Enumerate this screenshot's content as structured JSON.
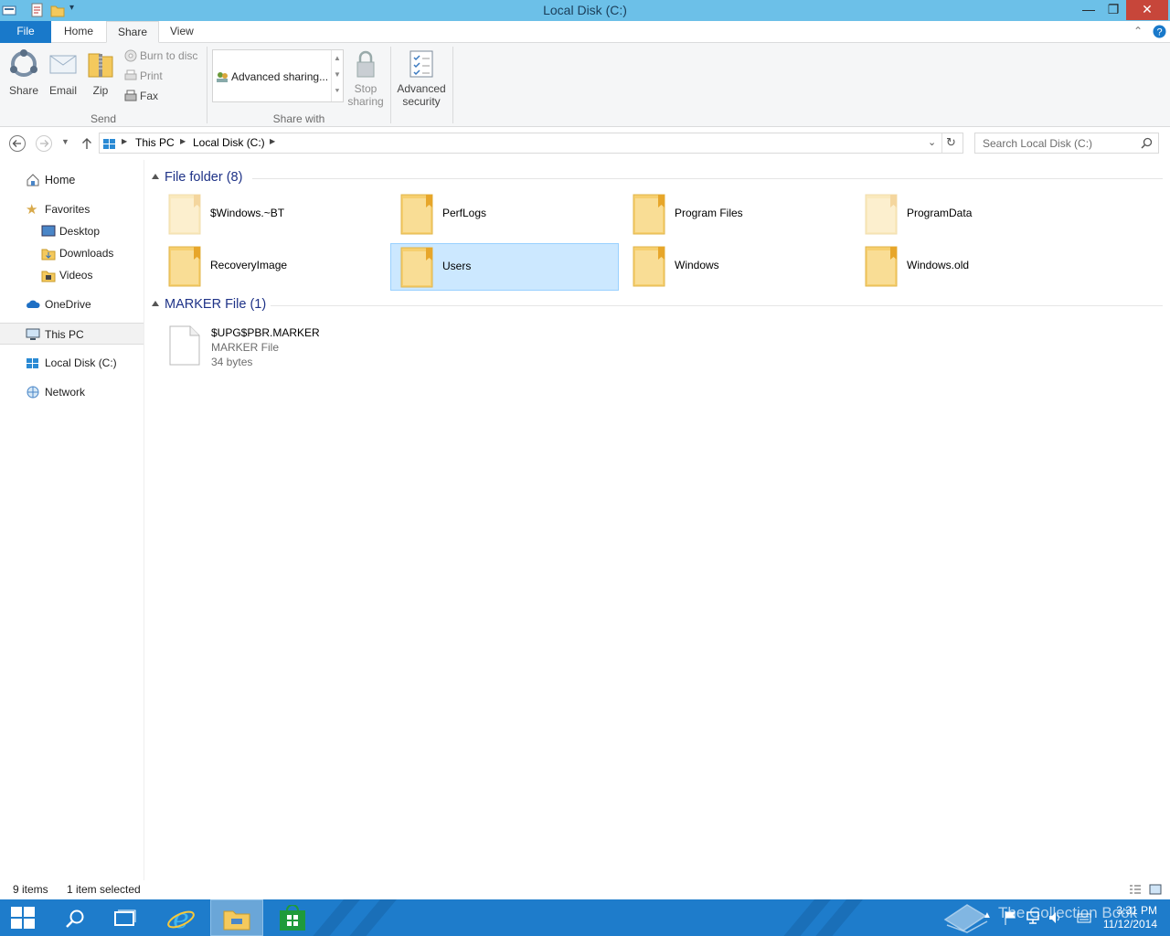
{
  "window": {
    "title": "Local Disk (C:)"
  },
  "ribbon": {
    "tabs": {
      "file": "File",
      "home": "Home",
      "share": "Share",
      "view": "View"
    },
    "send": {
      "share": "Share",
      "email": "Email",
      "zip": "Zip",
      "burn": "Burn to disc",
      "print": "Print",
      "fax": "Fax",
      "group_label": "Send"
    },
    "share_with": {
      "advanced_sharing": "Advanced sharing...",
      "stop_sharing_line1": "Stop",
      "stop_sharing_line2": "sharing",
      "group_label": "Share with"
    },
    "advanced_security_line1": "Advanced",
    "advanced_security_line2": "security"
  },
  "address": {
    "crumb1": "This PC",
    "crumb2": "Local Disk (C:)",
    "search_placeholder": "Search Local Disk (C:)"
  },
  "nav": {
    "home": "Home",
    "favorites": "Favorites",
    "desktop": "Desktop",
    "downloads": "Downloads",
    "videos": "Videos",
    "onedrive": "OneDrive",
    "thispc": "This PC",
    "localdisk": "Local Disk (C:)",
    "network": "Network"
  },
  "content": {
    "folder_group": "File folder (8)",
    "folders": [
      {
        "name": "$Windows.~BT",
        "hidden": true
      },
      {
        "name": "PerfLogs",
        "hidden": false
      },
      {
        "name": "Program Files",
        "hidden": false
      },
      {
        "name": "ProgramData",
        "hidden": true
      },
      {
        "name": "RecoveryImage",
        "hidden": false
      },
      {
        "name": "Users",
        "hidden": false,
        "selected": true
      },
      {
        "name": "Windows",
        "hidden": false
      },
      {
        "name": "Windows.old",
        "hidden": false
      }
    ],
    "marker_group": "MARKER File (1)",
    "marker_file": {
      "name": "$UPG$PBR.MARKER",
      "type": "MARKER File",
      "size": "34 bytes"
    }
  },
  "status": {
    "items": "9 items",
    "selected": "1 item selected"
  },
  "taskbar": {
    "time": "3:31 PM",
    "date": "11/12/2014",
    "watermark": "The Collection Book"
  },
  "colors": {
    "titlebar": "#6cc0e8",
    "file_tab": "#1979ca",
    "taskbar": "#1e7ccb",
    "selection": "#cce8ff",
    "group_header": "#1e3287"
  }
}
